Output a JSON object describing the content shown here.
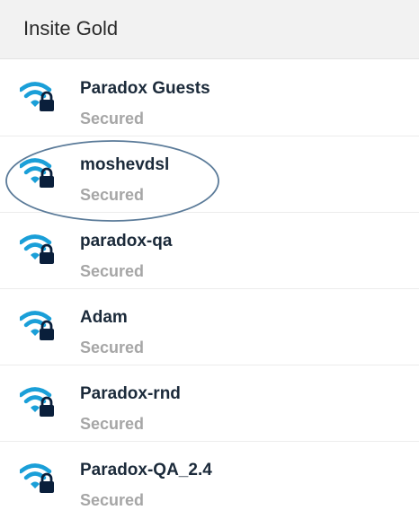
{
  "header": {
    "title": "Insite Gold"
  },
  "colors": {
    "wifi_icon": "#1a9fd8",
    "network_name": "#1b2a3a",
    "status_text": "#a6a6a6",
    "highlight_ellipse": "#5b7b99",
    "header_background": "#f2f2f2"
  },
  "networks": [
    {
      "name": "Paradox Guests",
      "status": "Secured",
      "icon": "wifi-locked-icon"
    },
    {
      "name": "moshevdsl",
      "status": "Secured",
      "icon": "wifi-locked-icon",
      "highlighted": true
    },
    {
      "name": "paradox-qa",
      "status": "Secured",
      "icon": "wifi-locked-icon"
    },
    {
      "name": "Adam",
      "status": "Secured",
      "icon": "wifi-locked-icon"
    },
    {
      "name": "Paradox-rnd",
      "status": "Secured",
      "icon": "wifi-locked-icon"
    },
    {
      "name": "Paradox-QA_2.4",
      "status": "Secured",
      "icon": "wifi-locked-icon"
    }
  ]
}
